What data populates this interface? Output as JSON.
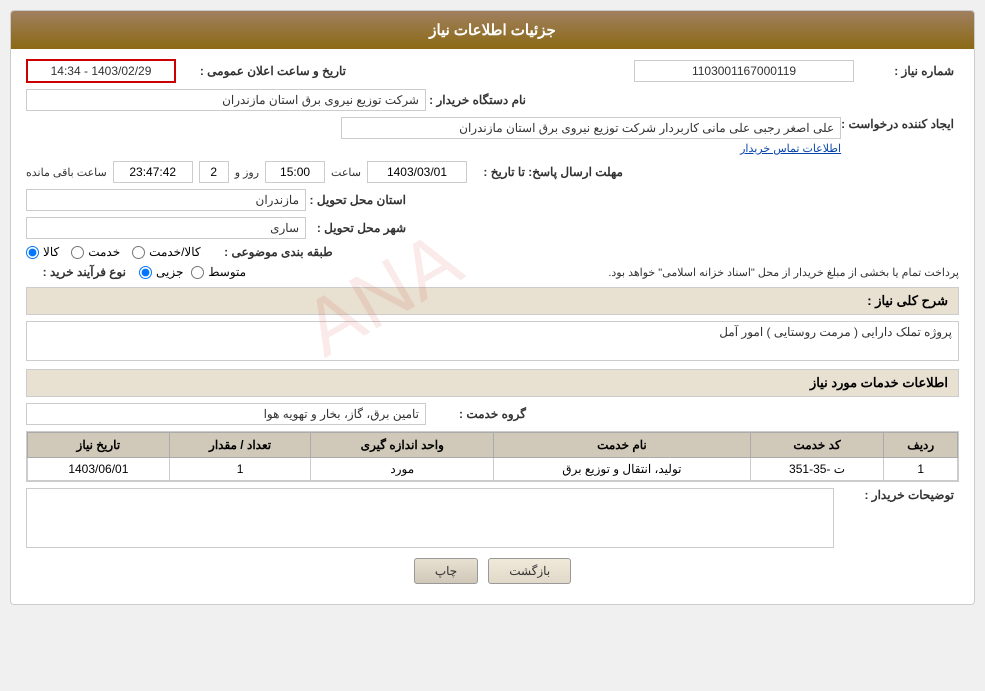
{
  "header": {
    "title": "جزئیات اطلاعات نیاز"
  },
  "fields": {
    "shomareNiaz_label": "شماره نیاز :",
    "shomareNiaz_value": "1103001167000119",
    "namDastgah_label": "نام دستگاه خریدار :",
    "namDastgah_value": "شرکت توزیع نیروی برق استان مازندران",
    "ijadKonande_label": "ایجاد کننده درخواست :",
    "ijadKonande_value": "علی اصغر رجبی علی مانی کاربردار شرکت توزیع نیروی برق استان مازندران",
    "ettelaat_link": "اطلاعات تماس خریدار",
    "mohlat_label": "مهلت ارسال پاسخ: تا تاریخ :",
    "tarikh_value": "1403/03/01",
    "saat_label": "ساعت",
    "saat_value": "15:00",
    "rooz_label": "روز و",
    "rooz_value": "2",
    "baghimande_label": "ساعت باقی مانده",
    "baghimande_value": "23:47:42",
    "tarikh_elan_label": "تاریخ و ساعت اعلان عمومی :",
    "tarikh_elan_value": "1403/02/29 - 14:34",
    "ostan_label": "استان محل تحویل :",
    "ostan_value": "مازندران",
    "shahr_label": "شهر محل تحویل :",
    "shahr_value": "ساری",
    "tabagheBandi_label": "طبقه بندی موضوعی :",
    "radio_kala": "کالا",
    "radio_khedmat": "خدمت",
    "radio_kala_khedmat": "کالا/خدمت",
    "noeFarayand_label": "نوع فرآیند خرید :",
    "radio_jozvi": "جزیی",
    "radio_motevaset": "متوسط",
    "purchase_note": "پرداخت تمام یا بخشی از مبلغ خریدار از محل \"اسناد خزانه اسلامی\" خواهد بود.",
    "sharhKoli_label": "شرح کلی نیاز :",
    "sharhKoli_value": "پروژه تملک دارایی ( مرمت روستایی ) امور آمل",
    "khadamat_header": "اطلاعات خدمات مورد نیاز",
    "gorohKhedmat_label": "گروه خدمت :",
    "gorohKhedmat_value": "تامین برق، گاز، بخار و تهویه هوا",
    "table": {
      "headers": [
        "ردیف",
        "کد خدمت",
        "نام خدمت",
        "واحد اندازه گیری",
        "تعداد / مقدار",
        "تاریخ نیاز"
      ],
      "rows": [
        {
          "radif": "1",
          "kodKhedmat": "ت -35-351",
          "namKhedmat": "تولید، انتقال و توزیع برق",
          "vahed": "مورد",
          "tedad": "1",
          "tarikh": "1403/06/01"
        }
      ]
    },
    "tozihat_label": "توضیحات خریدار :",
    "tozihat_value": "",
    "btn_print": "چاپ",
    "btn_back": "بازگشت"
  }
}
